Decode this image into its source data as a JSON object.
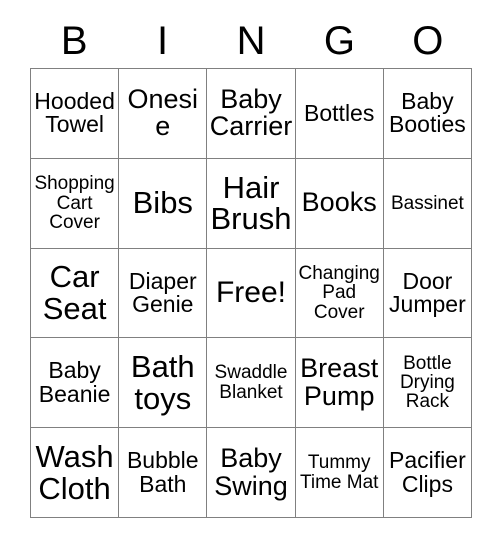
{
  "card": {
    "title": "BINGO",
    "header_letters": [
      "B",
      "I",
      "N",
      "G",
      "O"
    ],
    "rows": 5,
    "columns": 5,
    "free_space_label": "Free!",
    "grid_line_color": "#808080",
    "text_color": "#000000",
    "background_color": "#ffffff",
    "cells": [
      [
        {
          "text": "Hooded Towel",
          "size": "size-md",
          "free": false
        },
        {
          "text": "Onesie",
          "size": "size-lg",
          "free": false
        },
        {
          "text": "Baby Carrier",
          "size": "size-lg",
          "free": false
        },
        {
          "text": "Bottles",
          "size": "size-md",
          "free": false
        },
        {
          "text": "Baby Booties",
          "size": "size-md",
          "free": false
        }
      ],
      [
        {
          "text": "Shopping Cart Cover",
          "size": "size-sm",
          "free": false
        },
        {
          "text": "Bibs",
          "size": "size-xl",
          "free": false
        },
        {
          "text": "Hair Brush",
          "size": "size-xl",
          "free": false
        },
        {
          "text": "Books",
          "size": "size-lg",
          "free": false
        },
        {
          "text": "Bassinet",
          "size": "size-sm",
          "free": false
        }
      ],
      [
        {
          "text": "Car Seat",
          "size": "size-xl",
          "free": false
        },
        {
          "text": "Diaper Genie",
          "size": "size-md",
          "free": false
        },
        {
          "text": "Free!",
          "size": "size-free",
          "free": true
        },
        {
          "text": "Changing Pad Cover",
          "size": "size-sm",
          "free": false
        },
        {
          "text": "Door Jumper",
          "size": "size-md",
          "free": false
        }
      ],
      [
        {
          "text": "Baby Beanie",
          "size": "size-md",
          "free": false
        },
        {
          "text": "Bath toys",
          "size": "size-xl",
          "free": false
        },
        {
          "text": "Swaddle Blanket",
          "size": "size-sm",
          "free": false
        },
        {
          "text": "Breast Pump",
          "size": "size-lg",
          "free": false
        },
        {
          "text": "Bottle Drying Rack",
          "size": "size-sm",
          "free": false
        }
      ],
      [
        {
          "text": "Wash Cloth",
          "size": "size-xl",
          "free": false
        },
        {
          "text": "Bubble Bath",
          "size": "size-md",
          "free": false
        },
        {
          "text": "Baby Swing",
          "size": "size-lg",
          "free": false
        },
        {
          "text": "Tummy Time Mat",
          "size": "size-sm",
          "free": false
        },
        {
          "text": "Pacifier Clips",
          "size": "size-md",
          "free": false
        }
      ]
    ]
  }
}
